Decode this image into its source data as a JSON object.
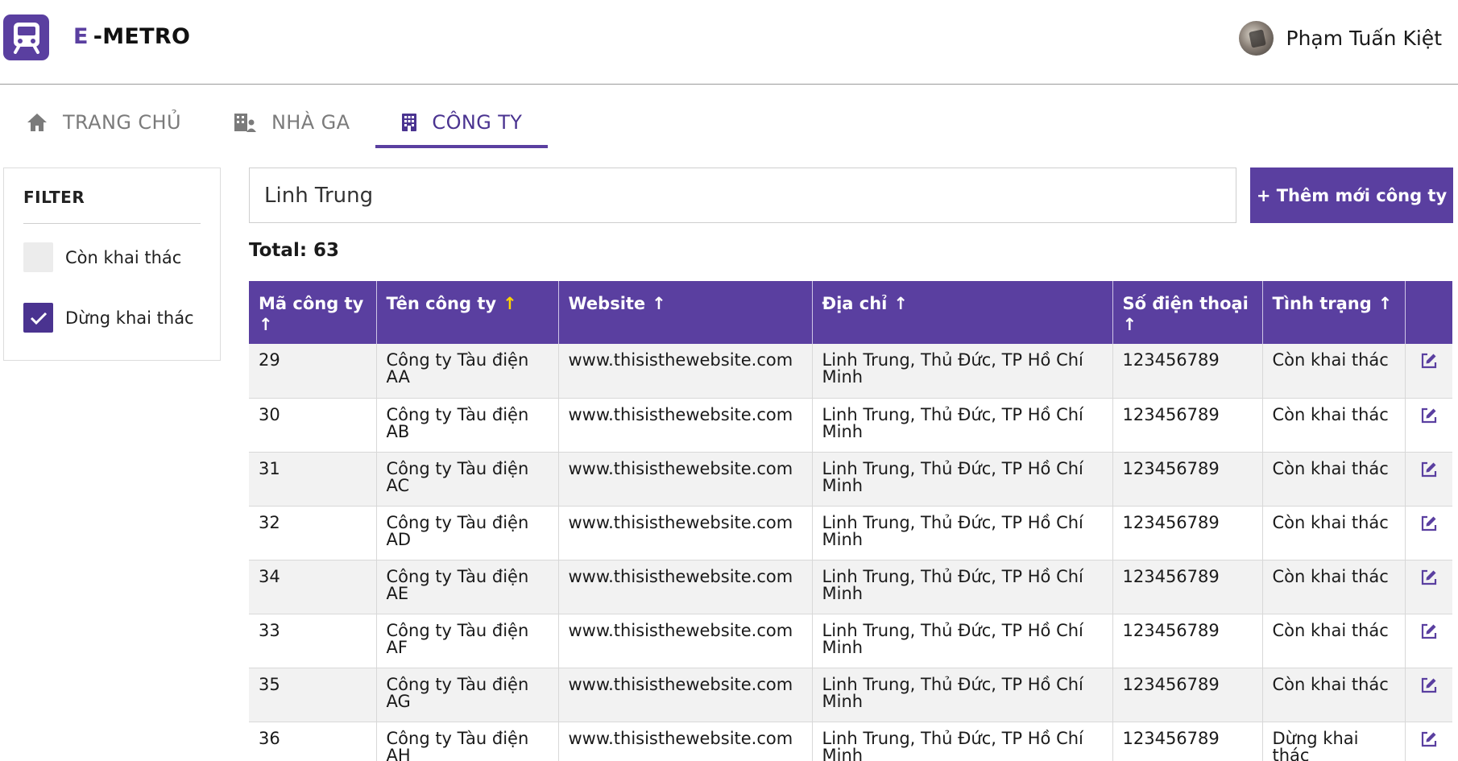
{
  "header": {
    "brand_e": "E",
    "brand_rest": "-METRO",
    "user_name": "Phạm Tuấn Kiệt"
  },
  "tabs": [
    {
      "label": "TRANG CHỦ",
      "icon": "home-icon",
      "active": false
    },
    {
      "label": "NHÀ GA",
      "icon": "station-icon",
      "active": false
    },
    {
      "label": "CÔNG TY",
      "icon": "building-icon",
      "active": true
    }
  ],
  "filter": {
    "title": "FILTER",
    "options": [
      {
        "label": "Còn khai thác",
        "checked": false
      },
      {
        "label": "Dừng khai thác",
        "checked": true
      }
    ]
  },
  "search": {
    "value": "Linh Trung",
    "placeholder": ""
  },
  "add_button": "+ Thêm mới công ty",
  "total_label": "Total: 63",
  "table": {
    "columns": [
      {
        "label": "Mã công ty",
        "arrow": "↑",
        "highlight": false
      },
      {
        "label": "Tên công ty",
        "arrow": "↑",
        "highlight": true
      },
      {
        "label": "Website",
        "arrow": "↑",
        "highlight": false
      },
      {
        "label": "Địa chỉ",
        "arrow": "↑",
        "highlight": false
      },
      {
        "label": "Số điện thoại",
        "arrow": "↑",
        "highlight": false
      },
      {
        "label": "Tình trạng",
        "arrow": "↑",
        "highlight": false
      },
      {
        "label": "",
        "arrow": "",
        "highlight": false
      }
    ],
    "rows": [
      {
        "id": "29",
        "name": "Công ty Tàu điện AA",
        "website": "www.thisisthewebsite.com",
        "address": "Linh Trung, Thủ Đức, TP Hồ Chí Minh",
        "phone": "123456789",
        "status": "Còn khai thác"
      },
      {
        "id": "30",
        "name": "Công ty Tàu điện AB",
        "website": "www.thisisthewebsite.com",
        "address": "Linh Trung, Thủ Đức, TP Hồ Chí Minh",
        "phone": "123456789",
        "status": "Còn khai thác"
      },
      {
        "id": "31",
        "name": "Công ty Tàu điện AC",
        "website": "www.thisisthewebsite.com",
        "address": "Linh Trung, Thủ Đức, TP Hồ Chí Minh",
        "phone": "123456789",
        "status": "Còn khai thác"
      },
      {
        "id": "32",
        "name": "Công ty Tàu điện AD",
        "website": "www.thisisthewebsite.com",
        "address": "Linh Trung, Thủ Đức, TP Hồ Chí Minh",
        "phone": "123456789",
        "status": "Còn khai thác"
      },
      {
        "id": "34",
        "name": "Công ty Tàu điện AE",
        "website": "www.thisisthewebsite.com",
        "address": "Linh Trung, Thủ Đức, TP Hồ Chí Minh",
        "phone": "123456789",
        "status": "Còn khai thác"
      },
      {
        "id": "33",
        "name": "Công ty Tàu điện AF",
        "website": "www.thisisthewebsite.com",
        "address": "Linh Trung, Thủ Đức, TP Hồ Chí Minh",
        "phone": "123456789",
        "status": "Còn khai thác"
      },
      {
        "id": "35",
        "name": "Công ty Tàu điện AG",
        "website": "www.thisisthewebsite.com",
        "address": "Linh Trung, Thủ Đức, TP Hồ Chí Minh",
        "phone": "123456789",
        "status": "Còn khai thác"
      },
      {
        "id": "36",
        "name": "Công ty Tàu điện AH",
        "website": "www.thisisthewebsite.com",
        "address": "Linh Trung, Thủ Đức, TP Hồ Chí Minh",
        "phone": "123456789",
        "status": "Dừng khai thác"
      }
    ]
  },
  "colors": {
    "accent": "#5a3fa0",
    "sort_highlight": "#ffd400"
  }
}
